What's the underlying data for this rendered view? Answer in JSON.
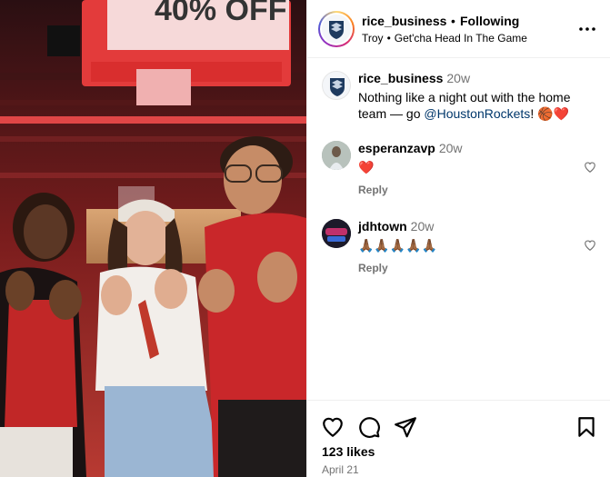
{
  "post": {
    "author": "rice_business",
    "separator": "•",
    "follow_status": "Following",
    "location": "Troy",
    "audio": "Get'cha Head In The Game",
    "photo_sign_text": "40% OFF"
  },
  "caption": {
    "username": "rice_business",
    "time": "20w",
    "text_before": "Nothing like a night out with the home team — go ",
    "mention": "@HoustonRockets",
    "text_after": "! 🏀❤️"
  },
  "comments": [
    {
      "username": "esperanzavp",
      "time": "20w",
      "text": "❤️",
      "reply_label": "Reply"
    },
    {
      "username": "jdhtown",
      "time": "20w",
      "text": "🙏🏾🙏🏾🙏🏾🙏🏾🙏🏾",
      "reply_label": "Reply"
    }
  ],
  "footer": {
    "likes": "123 likes",
    "date": "April 21"
  },
  "icons": {
    "more": "more-options-icon",
    "like": "heart-icon",
    "comment": "comment-icon",
    "share": "share-icon",
    "save": "bookmark-icon"
  }
}
